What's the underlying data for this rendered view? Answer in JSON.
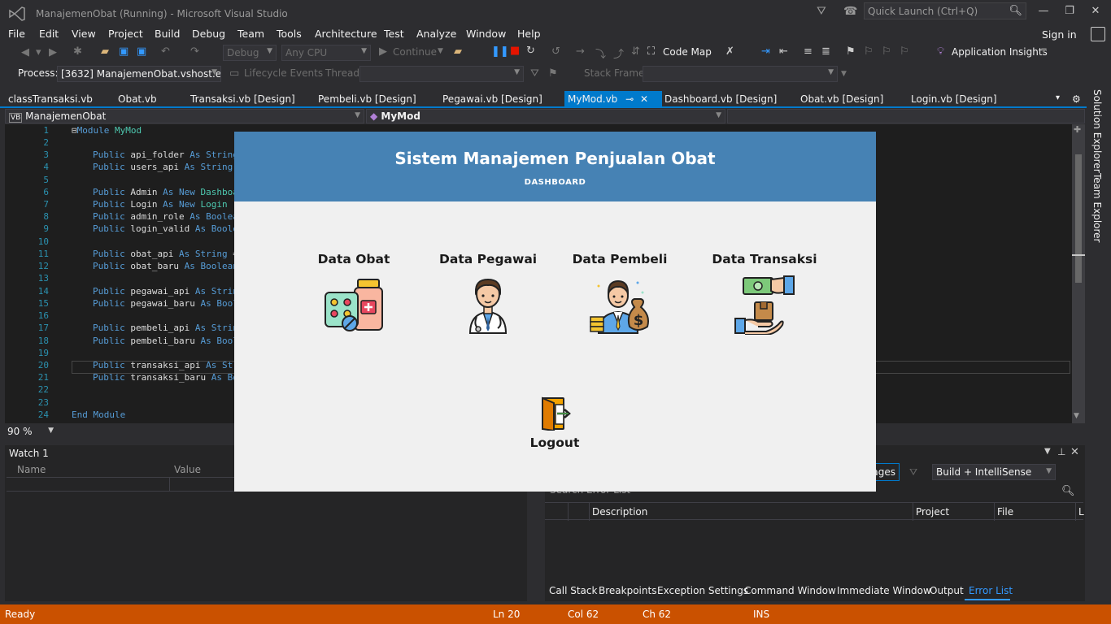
{
  "window": {
    "title": "ManajemenObat (Running) - Microsoft Visual Studio",
    "quick_launch_placeholder": "Quick Launch (Ctrl+Q)"
  },
  "menu": {
    "items": [
      "File",
      "Edit",
      "View",
      "Project",
      "Build",
      "Debug",
      "Team",
      "Tools",
      "Architecture",
      "Test",
      "Analyze",
      "Window",
      "Help"
    ],
    "sign_in": "Sign in"
  },
  "toolbar": {
    "config": "Debug",
    "platform": "Any CPU",
    "continue_label": "Continue",
    "code_map_label": "Code Map",
    "app_insights_label": "Application Insights",
    "process_label": "Process:",
    "process_value": "[3632] ManajemenObat.vshost.exe",
    "lifecycle_label": "Lifecycle Events",
    "thread_label": "Thread:",
    "stack_frame_label": "Stack Frame:"
  },
  "doc_tabs": [
    "classTransaksi.vb",
    "Obat.vb",
    "Transaksi.vb [Design]",
    "Pembeli.vb [Design]",
    "Pegawai.vb [Design]",
    "MyMod.vb",
    "Dashboard.vb [Design]",
    "Obat.vb [Design]",
    "Login.vb [Design]"
  ],
  "nav": {
    "project": "ManajemenObat",
    "module": "MyMod"
  },
  "editor": {
    "line_numbers": [
      "1",
      "2",
      "3",
      "4",
      "5",
      "6",
      "7",
      "8",
      "9",
      "10",
      "11",
      "12",
      "13",
      "14",
      "15",
      "16",
      "17",
      "18",
      "19",
      "20",
      "21",
      "22",
      "23",
      "24"
    ],
    "zoom": "90 %"
  },
  "watch": {
    "title": "Watch 1",
    "col_name": "Name",
    "col_value": "Value"
  },
  "error_list": {
    "messages_btn": "ages",
    "build_filter": "Build + IntelliSense",
    "search_placeholder": "Search Error List",
    "col_description": "Description",
    "col_project": "Project",
    "col_file": "File",
    "col_line": "L"
  },
  "bottom_tabs": [
    "Call Stack",
    "Breakpoints",
    "Exception Settings",
    "Command Window",
    "Immediate Window",
    "Output",
    "Error List"
  ],
  "side_tabs": [
    "Solution Explorer",
    "Team Explorer"
  ],
  "status": {
    "state": "Ready",
    "ln": "Ln 20",
    "col": "Col 62",
    "ch": "Ch 62",
    "mode": "INS"
  },
  "app": {
    "title": "Sistem Manajemen Penjualan Obat",
    "subtitle": "DASHBOARD",
    "menu": [
      {
        "label": "Data Obat",
        "icon": "medicine-icon"
      },
      {
        "label": "Data Pegawai",
        "icon": "doctor-icon"
      },
      {
        "label": "Data Pembeli",
        "icon": "buyer-icon"
      },
      {
        "label": "Data Transaksi",
        "icon": "transaction-icon"
      }
    ],
    "logout_label": "Logout",
    "header_color": "#4682B4",
    "accent_status_color": "#CA5100"
  }
}
